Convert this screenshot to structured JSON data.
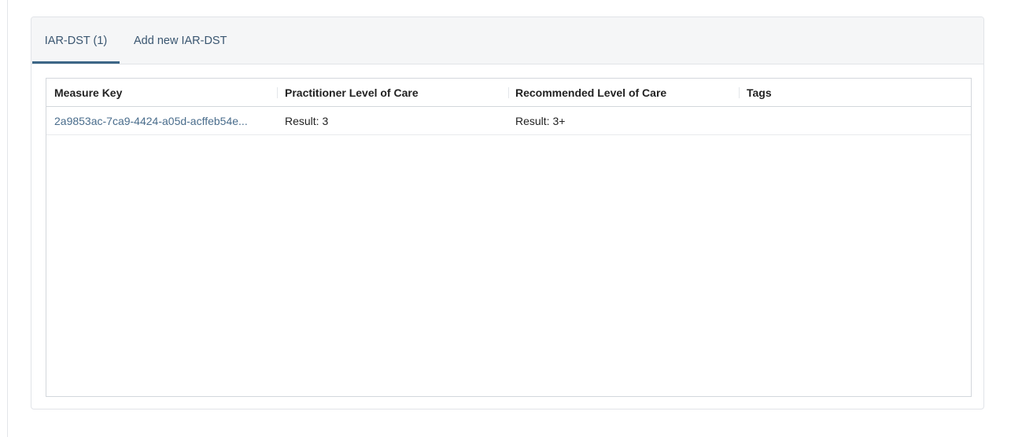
{
  "tabs": [
    {
      "label": "IAR-DST (1)",
      "active": true
    },
    {
      "label": "Add new IAR-DST",
      "active": false
    }
  ],
  "grid": {
    "columns": [
      "Measure Key",
      "Practitioner Level of Care",
      "Recommended Level of Care",
      "Tags"
    ],
    "rows": [
      {
        "measure_key": "2a9853ac-7ca9-4424-a05d-acffeb54e...",
        "practitioner_level_of_care": "Result: 3",
        "recommended_level_of_care": "Result: 3+",
        "tags": ""
      }
    ]
  },
  "colors": {
    "tab_active_underline": "#3d6687",
    "link": "#4a6d8c",
    "tabbar_bg": "#f5f6f7"
  }
}
